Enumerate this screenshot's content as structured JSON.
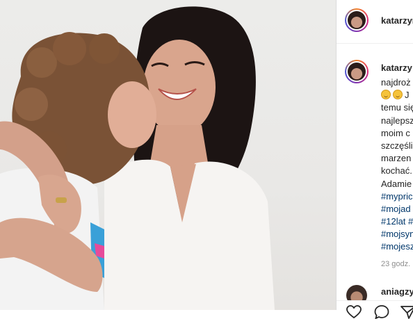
{
  "post": {
    "image_alt": "",
    "username": "katarzyn",
    "caption": {
      "author": "katarzy",
      "lines": [
        "najdroż",
        "J",
        "temu się",
        "najlepsz",
        "moim c",
        "szczęśli",
        "marzen",
        "kochać.",
        "Adamie"
      ],
      "hashtags": [
        "#mypric",
        "#mojad",
        "#12lat #",
        "#mojsyn",
        "#mojesz"
      ]
    },
    "timestamp": "23 godz.",
    "comment_user": "aniagzy"
  },
  "icons": [
    "heart-icon",
    "comment-icon",
    "share-icon"
  ],
  "colors": {
    "hashtag": "#00376b",
    "text": "#262626",
    "muted": "#8e8e8e"
  }
}
